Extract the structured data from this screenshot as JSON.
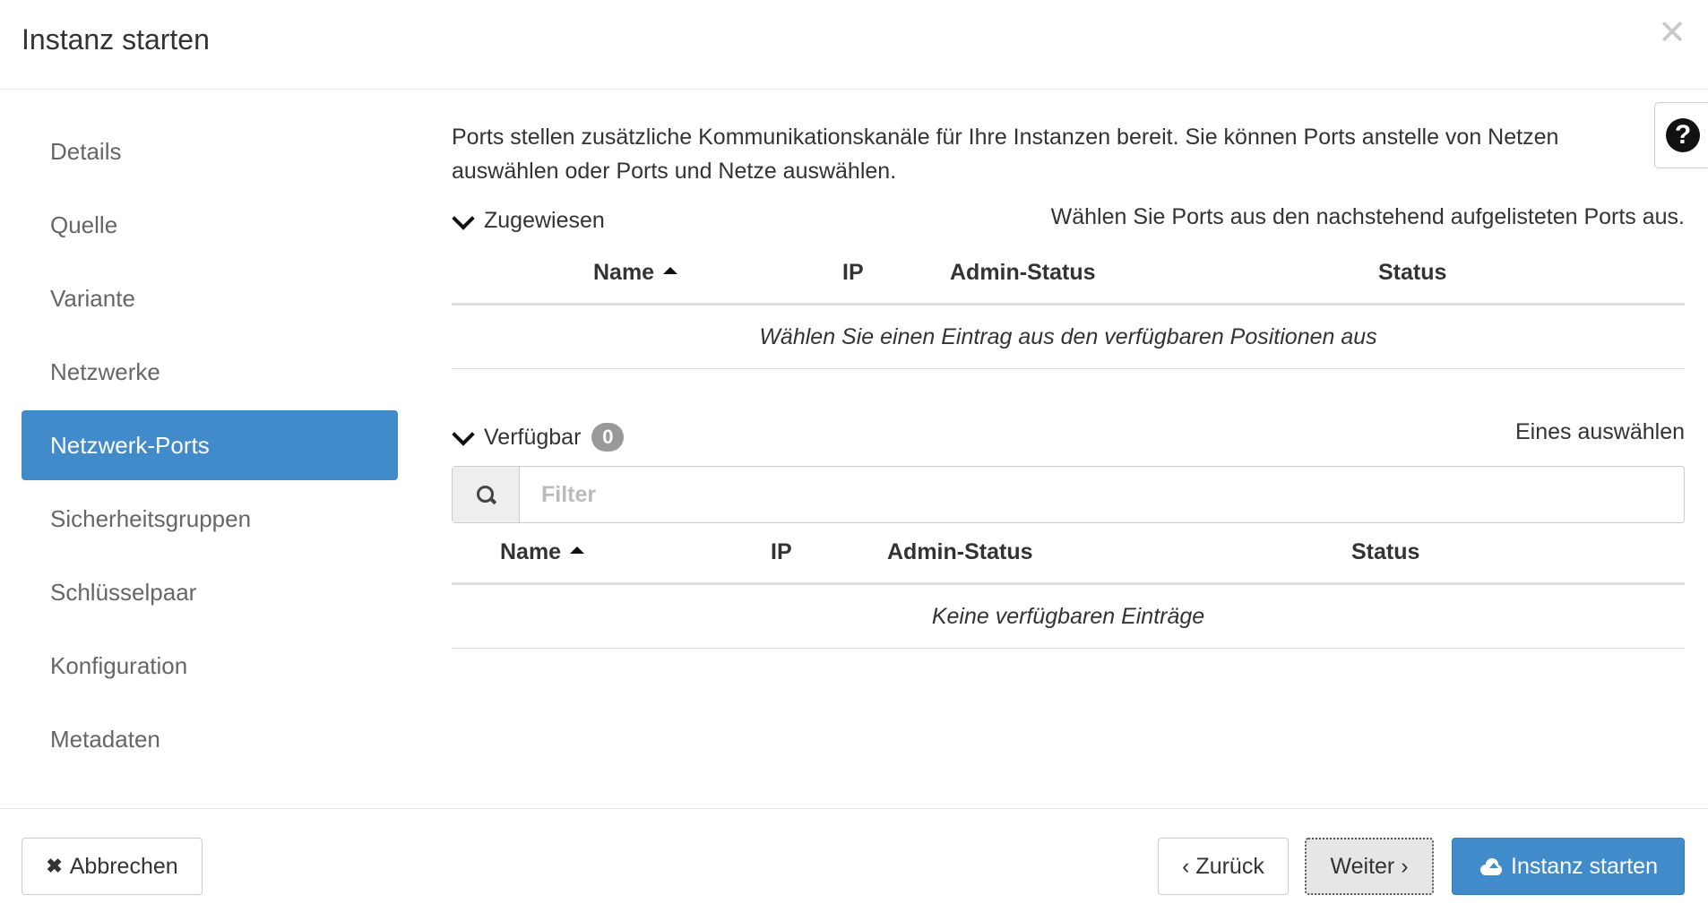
{
  "dialog": {
    "title": "Instanz starten",
    "close_icon": "close-icon",
    "help_icon": "question-circle-icon"
  },
  "sidebar": {
    "items": [
      {
        "label": "Details"
      },
      {
        "label": "Quelle"
      },
      {
        "label": "Variante"
      },
      {
        "label": "Netzwerke"
      },
      {
        "label": "Netzwerk-Ports",
        "active": true
      },
      {
        "label": "Sicherheitsgruppen"
      },
      {
        "label": "Schlüsselpaar"
      },
      {
        "label": "Konfiguration"
      },
      {
        "label": "Metadaten"
      }
    ]
  },
  "main": {
    "intro": "Ports stellen zusätzliche Kommunikationskanäle für Ihre Instanzen bereit. Sie können Ports anstelle von Netzen auswählen oder Ports und Netze auswählen.",
    "allocated": {
      "toggle_label": "Zugewiesen",
      "help_text": "Wählen Sie Ports aus den nachstehend aufgelisteten Ports aus.",
      "columns": [
        "Name",
        "IP",
        "Admin-Status",
        "Status"
      ],
      "empty_text": "Wählen Sie einen Eintrag aus den verfügbaren Positionen aus"
    },
    "available": {
      "toggle_label": "Verfügbar",
      "count": "0",
      "help_text": "Eines auswählen",
      "filter_placeholder": "Filter",
      "columns": [
        "Name",
        "IP",
        "Admin-Status",
        "Status"
      ],
      "empty_text": "Keine verfügbaren Einträge"
    }
  },
  "footer": {
    "cancel_label": "Abbrechen",
    "back_label": "‹ Zurück",
    "next_label": "Weiter ›",
    "launch_label": "Instanz starten"
  },
  "colors": {
    "primary": "#428bca",
    "badge": "#999999"
  }
}
